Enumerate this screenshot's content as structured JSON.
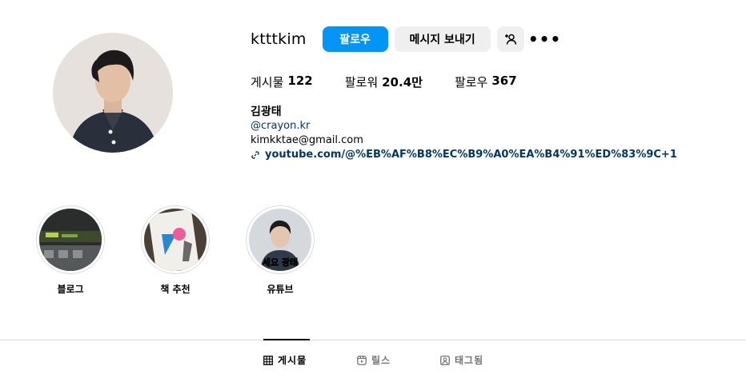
{
  "profile": {
    "username": "ktttkim",
    "follow_label": "팔로우",
    "message_label": "메시지 보내기",
    "suggest_icon": "add-person-icon",
    "more_label": "•••"
  },
  "stats": {
    "posts_label": "게시물",
    "posts_value": "122",
    "followers_label": "팔로워",
    "followers_value": "20.4만",
    "following_label": "팔로우",
    "following_value": "367"
  },
  "bio": {
    "full_name": "김광태",
    "handle": "@crayon.kr",
    "email": "kimkktae@gmail.com",
    "link": "youtube.com/@%EB%AF%B8%EC%B9%A0%EA%B4%91%ED%83%9C+1"
  },
  "highlights": [
    {
      "label": "블로그",
      "caption": ""
    },
    {
      "label": "책 추천",
      "caption": ""
    },
    {
      "label": "유튜브",
      "caption": "세요 광태"
    }
  ],
  "tabs": [
    {
      "label": "게시물",
      "icon": "grid-icon",
      "active": true
    },
    {
      "label": "릴스",
      "icon": "reels-icon",
      "active": false
    },
    {
      "label": "태그됨",
      "icon": "tagged-icon",
      "active": false
    }
  ],
  "colors": {
    "primary_button": "#0095f6",
    "secondary_button": "#efefef",
    "link": "#00376b",
    "divider": "#dbdbdb"
  }
}
